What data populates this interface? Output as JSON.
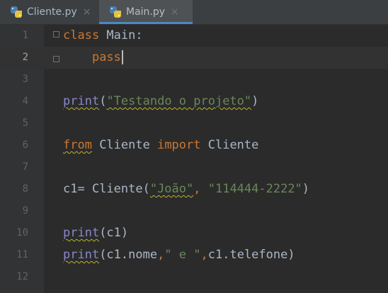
{
  "tabs": [
    {
      "label": "Cliente.py",
      "icon": "python-file-icon",
      "active": false
    },
    {
      "label": "Main.py",
      "icon": "python-file-icon",
      "active": true
    }
  ],
  "tab_close_glyph": "×",
  "editor": {
    "current_line": 2,
    "lines": [
      {
        "n": "1",
        "tokens": [
          {
            "t": "class",
            "c": "kw"
          },
          {
            "t": " Main:",
            "c": ""
          }
        ]
      },
      {
        "n": "2",
        "tokens": [
          {
            "t": "    ",
            "c": ""
          },
          {
            "t": "pass",
            "c": "kw"
          }
        ]
      },
      {
        "n": "3",
        "tokens": []
      },
      {
        "n": "4",
        "tokens": [
          {
            "t": "print",
            "c": "fn"
          },
          {
            "t": "(",
            "c": ""
          },
          {
            "t": "\"Testando o projeto\"",
            "c": "str"
          },
          {
            "t": ")",
            "c": ""
          }
        ]
      },
      {
        "n": "5",
        "tokens": []
      },
      {
        "n": "6",
        "tokens": [
          {
            "t": "from",
            "c": "kw"
          },
          {
            "t": " Cliente ",
            "c": ""
          },
          {
            "t": "import",
            "c": "kw"
          },
          {
            "t": " Cliente",
            "c": ""
          }
        ]
      },
      {
        "n": "7",
        "tokens": []
      },
      {
        "n": "8",
        "tokens": [
          {
            "t": "c1= Cliente(",
            "c": ""
          },
          {
            "t": "\"João\"",
            "c": "str"
          },
          {
            "t": ", ",
            "c": "kw"
          },
          {
            "t": "\"114444-2222\"",
            "c": "str"
          },
          {
            "t": ")",
            "c": ""
          }
        ]
      },
      {
        "n": "9",
        "tokens": []
      },
      {
        "n": "10",
        "tokens": [
          {
            "t": "print",
            "c": "fn"
          },
          {
            "t": "(c1)",
            "c": ""
          }
        ]
      },
      {
        "n": "11",
        "tokens": [
          {
            "t": "print",
            "c": "fn"
          },
          {
            "t": "(c1.nome",
            "c": ""
          },
          {
            "t": ",",
            "c": "kw"
          },
          {
            "t": "\" e \"",
            "c": "str"
          },
          {
            "t": ",",
            "c": "kw"
          },
          {
            "t": "c1.telefone)",
            "c": ""
          }
        ]
      },
      {
        "n": "12",
        "tokens": []
      }
    ]
  },
  "colors": {
    "keyword": "#cc7832",
    "string": "#6a8759",
    "builtin": "#8888c6",
    "text": "#a9b7c6",
    "background": "#2b2b2b",
    "gutter": "#313335"
  }
}
